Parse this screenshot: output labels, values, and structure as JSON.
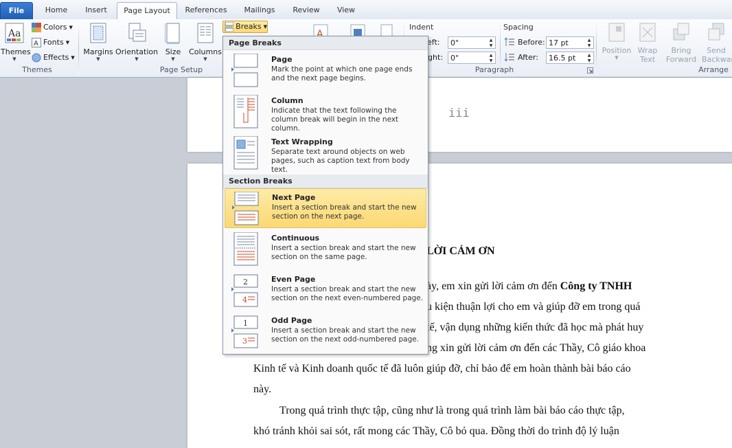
{
  "tabs": [
    {
      "label": "File"
    },
    {
      "label": "Home"
    },
    {
      "label": "Insert"
    },
    {
      "label": "Page Layout"
    },
    {
      "label": "References"
    },
    {
      "label": "Mailings"
    },
    {
      "label": "Review"
    },
    {
      "label": "View"
    }
  ],
  "ribbon": {
    "themes": {
      "themes_label": "Themes",
      "colors_label": "Colors",
      "fonts_label": "Fonts",
      "effects_label": "Effects",
      "group_label": "Themes"
    },
    "page_setup": {
      "margins_label": "Margins",
      "orientation_label": "Orientation",
      "size_label": "Size",
      "columns_label": "Columns",
      "breaks_label": "Breaks",
      "group_label": "Page Setup"
    },
    "paragraph": {
      "indent_label": "Indent",
      "left_label": "eft:",
      "left_value": "0\"",
      "right_label": "ight:",
      "right_value": "0\"",
      "spacing_label": "Spacing",
      "before_label": "Before:",
      "before_value": "17 pt",
      "after_label": "After:",
      "after_value": "16.5 pt",
      "group_label": "Paragraph"
    },
    "arrange": {
      "position_label": "Position",
      "wrap_label_1": "Wrap",
      "wrap_label_2": "Text",
      "bring_label_1": "Bring",
      "bring_label_2": "Forward",
      "send_label_1": "Send",
      "send_label_2": "Backwar",
      "group_label": "Arrange"
    }
  },
  "breaks_menu": {
    "page_breaks_header": "Page Breaks",
    "section_breaks_header": "Section Breaks",
    "items": [
      {
        "title": "Page",
        "desc": "Mark the point at which one page ends and the next page begins.",
        "icon": "page-break-icon"
      },
      {
        "title": "Column",
        "desc": "Indicate that the text following the column break will begin in the next column.",
        "icon": "column-break-icon"
      },
      {
        "title": "Text Wrapping",
        "desc": "Separate text around objects on web pages, such as caption text from body text.",
        "icon": "text-wrapping-break-icon"
      },
      {
        "title": "Next Page",
        "desc": "Insert a section break and start the new section on the next page.",
        "icon": "next-page-break-icon"
      },
      {
        "title": "Continuous",
        "desc": "Insert a section break and start the new section on the same page.",
        "icon": "continuous-break-icon"
      },
      {
        "title": "Even Page",
        "desc": "Insert a section break and start the new section on the next even-numbered page.",
        "icon": "even-page-break-icon"
      },
      {
        "title": "Odd Page",
        "desc": "Insert a section break and start the new section on the next odd-numbered page.",
        "icon": "odd-page-break-icon"
      }
    ]
  },
  "document": {
    "page_number": "iii",
    "heading": "LỜI CẢM ƠN",
    "line1_a": "ày, em xin gửi lời cảm ơn đến ",
    "line1_b": "Công ty TNHH",
    "line2": "u kiện thuận lợi cho em và giúp đỡ em trong quá",
    "line3": "tế, vận dụng những kiến thức đã học mà phát huy",
    "line4": "ng xin gửi lời cảm ơn đến các Thầy, Cô giáo khoa",
    "line5": "Kinh tế và Kinh doanh quốc tế đã luôn giúp đỡ, chỉ bảo để em hoàn thành bài báo cáo",
    "line6": "này.",
    "line7": "Trong quá trình thực tập, cũng như là trong quá trình làm bài báo cáo thực tập,",
    "line8": "khó tránh khỏi sai sót, rất mong các Thầy, Cô bỏ qua. Đồng thời do trình độ lý luận"
  },
  "colors": {
    "highlight": "#fbd873",
    "file_tab": "#2a6ac5",
    "accent_red": "#d24726"
  }
}
